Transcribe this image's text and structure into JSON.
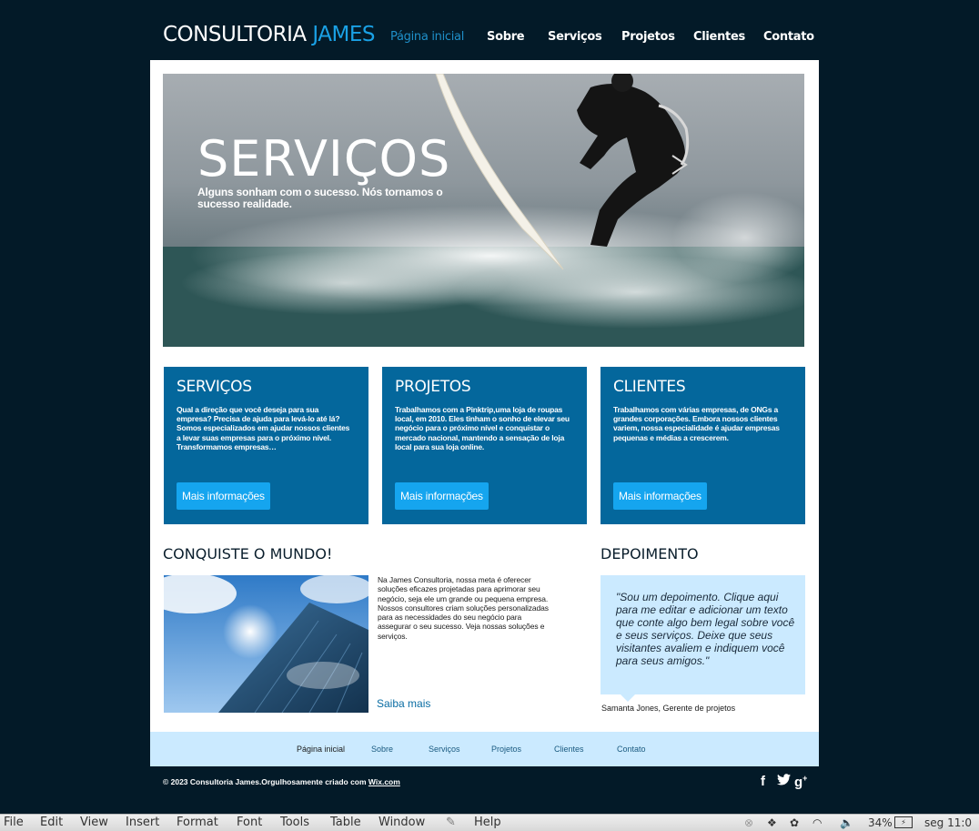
{
  "header": {
    "logo_main": "CONSULTORIA ",
    "logo_accent": "JAMES",
    "nav": [
      "Página inicial",
      "Sobre",
      "Serviços",
      "Projetos",
      "Clientes",
      "Contato"
    ]
  },
  "hero": {
    "title": "SERVIÇOS",
    "subtitle": "Alguns sonham com o sucesso. Nós tornamos o sucesso realidade."
  },
  "boxes": [
    {
      "title": "SERVIÇOS",
      "text": "Qual a direção que você deseja para sua empresa? Precisa de ajuda para levá-lo até lá? Somos especializados em ajudar nossos clientes a levar suas empresas para o próximo nível. Transformamos empresas…",
      "button": "Mais informações"
    },
    {
      "title": "PROJETOS",
      "text": "Trabalhamos com a Pinktrip,uma loja de roupas local, em 2010. Eles tinham o sonho de elevar seu negócio para o próximo nível e conquistar o mercado nacional, mantendo a sensação de loja local para sua loja online.",
      "button": "Mais informações"
    },
    {
      "title": "CLIENTES",
      "text": "Trabalhamos com várias empresas, de ONGs a grandes corporações. Embora nossos clientes variem, nossa especialidade é ajudar empresas pequenas e médias a crescerem.",
      "button": "Mais informações"
    }
  ],
  "conquiste": {
    "title": "CONQUISTE O MUNDO!",
    "text": "Na James Consultoria, nossa meta é oferecer soluções eficazes projetadas para aprimorar seu negócio, seja ele um grande ou pequena empresa. Nossos consultores criam soluções personalizadas para as necessidades do seu negócio para assegurar o seu sucesso. Veja nossas soluções e serviços.",
    "link": "Saiba mais"
  },
  "depoimento": {
    "title": "DEPOIMENTO",
    "quote": "\"Sou um depoimento. Clique aqui para me editar e adicionar um texto que conte algo bem legal sobre você e seus serviços. Deixe que seus visitantes avaliem e indiquem você para seus amigos.\"",
    "author": "Samanta Jones, Gerente de projetos"
  },
  "footer": {
    "nav": [
      "Página inicial",
      "Sobre",
      "Serviços",
      "Projetos",
      "Clientes",
      "Contato"
    ],
    "copyright": "© 2023 Consultoria James.Orgulhosamente criado com ",
    "copyright_link": "Wix.com",
    "social": [
      "facebook-icon",
      "twitter-icon",
      "google-plus-icon"
    ]
  },
  "menubar": {
    "items": [
      "File",
      "Edit",
      "View",
      "Insert",
      "Format",
      "Font",
      "Tools",
      "Table",
      "Window",
      "Help"
    ],
    "battery": "34%",
    "clock": "seg 11:0"
  },
  "colors": {
    "background": "#031a28",
    "accent": "#1aa1e5",
    "box": "#04679c",
    "button": "#15a5ef",
    "light_blue": "#cbeaff"
  }
}
